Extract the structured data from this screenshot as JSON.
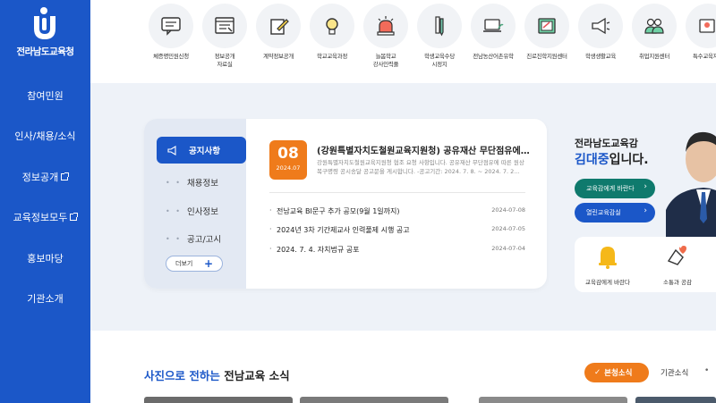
{
  "sidebar": {
    "logo_text": "전라남도교육청",
    "items": [
      {
        "label": "참여민원",
        "external": false
      },
      {
        "label": "인사/채용/소식",
        "external": false
      },
      {
        "label": "정보공개",
        "external": true
      },
      {
        "label": "교육정보모두",
        "external": true
      },
      {
        "label": "홍보마당",
        "external": false
      },
      {
        "label": "기관소개",
        "external": false
      }
    ]
  },
  "top_icons": [
    {
      "label": "체증명민원신청",
      "icon": "chat-monitor-icon"
    },
    {
      "label": "정보공개\n자료실",
      "icon": "document-list-icon"
    },
    {
      "label": "계약정보공개",
      "icon": "contract-pen-icon"
    },
    {
      "label": "학교교육과정",
      "icon": "lightbulb-icon"
    },
    {
      "label": "늘봄학교\n강사인력풀",
      "icon": "siren-icon"
    },
    {
      "label": "학생교육수당\n시정지",
      "icon": "pencil-ruler-icon"
    },
    {
      "label": "전남농산어촌유학",
      "icon": "laptop-plant-icon"
    },
    {
      "label": "진로진학지원센터",
      "icon": "certificate-icon"
    },
    {
      "label": "학생생활교육",
      "icon": "megaphone-icon"
    },
    {
      "label": "취업지원센터",
      "icon": "people-icon"
    },
    {
      "label": "특수교육지원",
      "icon": "support-icon"
    }
  ],
  "notice": {
    "tabs": {
      "active": "공지사항",
      "items": [
        "채용정보",
        "인사정보",
        "공고/고시"
      ],
      "more_label": "더보기",
      "dots": "• •"
    },
    "featured": {
      "day": "08",
      "year_month": "2024.07",
      "title": "(강원특별자치도철원교육지원청) 공유재산 무단점유에 따...",
      "desc": "강원특별자치도철원교육지원청 협조 요청 사항입니다. 공유재산 무단점유에 따른 원상복구명령 공시송달 공고문을 게시합니다. -공고기간: 2024. 7. 8. ~ 2024. 7. 2..."
    },
    "list": [
      {
        "title": "전남교육 BI문구 추가 공모(9월 1일까지)",
        "date": "2024-07-08"
      },
      {
        "title": "2024년 3차 기간제교사 인력풀제 시행 공고",
        "date": "2024-07-05"
      },
      {
        "title": "2024. 7. 4. 자치법규 공포",
        "date": "2024-07-04"
      }
    ],
    "bullet": "·"
  },
  "superintendent": {
    "org": "전라남도교육감",
    "name_highlight": "김대중",
    "name_suffix": "입니다.",
    "btn_message": "교육감에게 바란다",
    "btn_open": "열린교육감실",
    "arrow": "›",
    "quick": [
      {
        "label": "교육감에게 바란다",
        "icon": "bell-icon"
      },
      {
        "label": "소통과 공감",
        "icon": "handshake-heart-icon"
      }
    ]
  },
  "photos": {
    "title_highlight": "사진으로 전하는",
    "title_rest": " 전남교육 소식",
    "tab_active": "본청소식",
    "tab_active_check": "✓",
    "tab_other": "기관소식",
    "sep": "•"
  },
  "more_plus": "+",
  "colors": {
    "primary": "#1b57c8",
    "orange": "#ef7b1b",
    "green": "#0f7a6d",
    "bg": "#eef2f8"
  }
}
